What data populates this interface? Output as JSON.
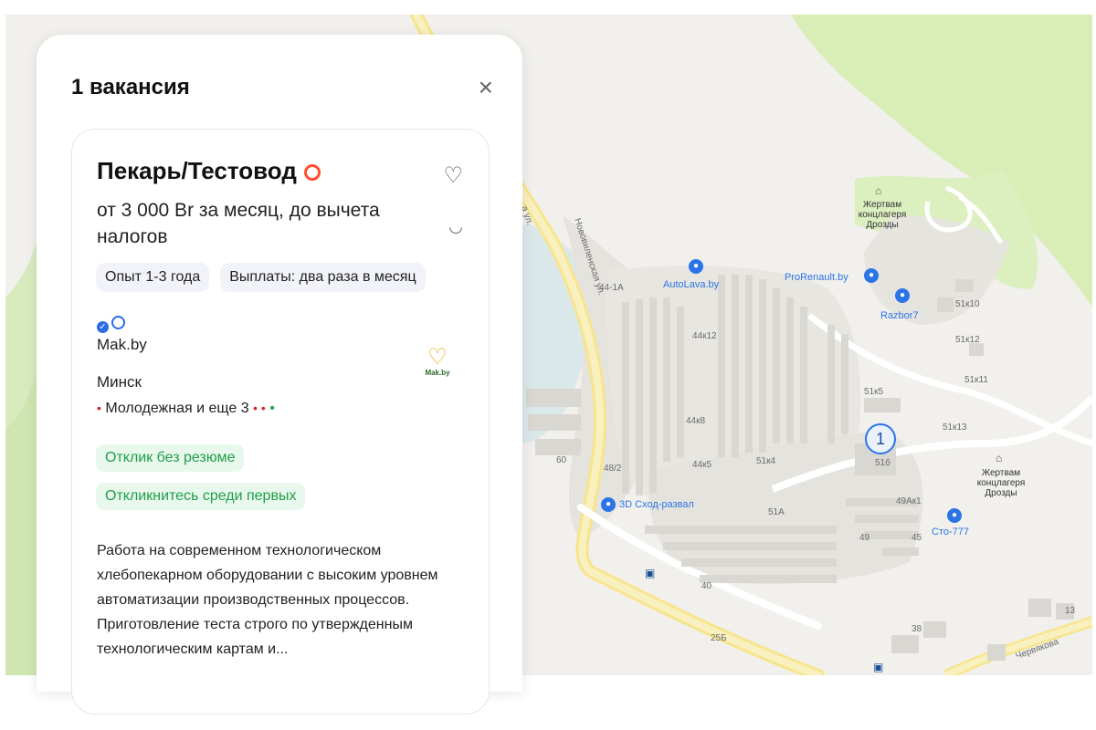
{
  "panel": {
    "title": "1 вакансия",
    "close_icon": "×"
  },
  "vacancy": {
    "title": "Пекарь/Тестовод",
    "salary": "от 3 000 Br за месяц, до вычета налогов",
    "tags": [
      "Опыт 1-3 года",
      "Выплаты: два раза в месяц"
    ],
    "company": "Mak.by",
    "city": "Минск",
    "metro": "Молодежная и еще 3",
    "response_tags": [
      "Отклик без резюме",
      "Откликнитесь среди первых"
    ],
    "description": "Работа на современном технологическом хлебопекарном оборудовании с высоким уровнем автоматизации производственных процессов. Приготовление теста строго по утвержденным технологическим картам и...",
    "logo_text": "Mak.by"
  },
  "map": {
    "streets": [
      "Нововиленская ул.",
      "а ул.",
      "Червякова"
    ],
    "numbers": [
      "44-1А",
      "44к12",
      "44к8",
      "44к5",
      "51к4",
      "51А",
      "49Ак1",
      "49",
      "45",
      "51б",
      "51к5",
      "51к10",
      "51к12",
      "51к11",
      "51к13",
      "48/2",
      "60",
      "40",
      "25Б",
      "38",
      "13"
    ],
    "pois": [
      "AutoLava.by",
      "ProRenault.by",
      "Razbor7",
      "3D Сход-развал",
      "Сто-777"
    ],
    "memorials": [
      "Жертвам концлагеря Дрозды",
      "Жертвам концлагеря Дрозды"
    ],
    "marker_count": "1"
  },
  "colors": {
    "accent": "#2b74e8",
    "success": "#1e9f48",
    "hot": "#ff4d2e"
  }
}
